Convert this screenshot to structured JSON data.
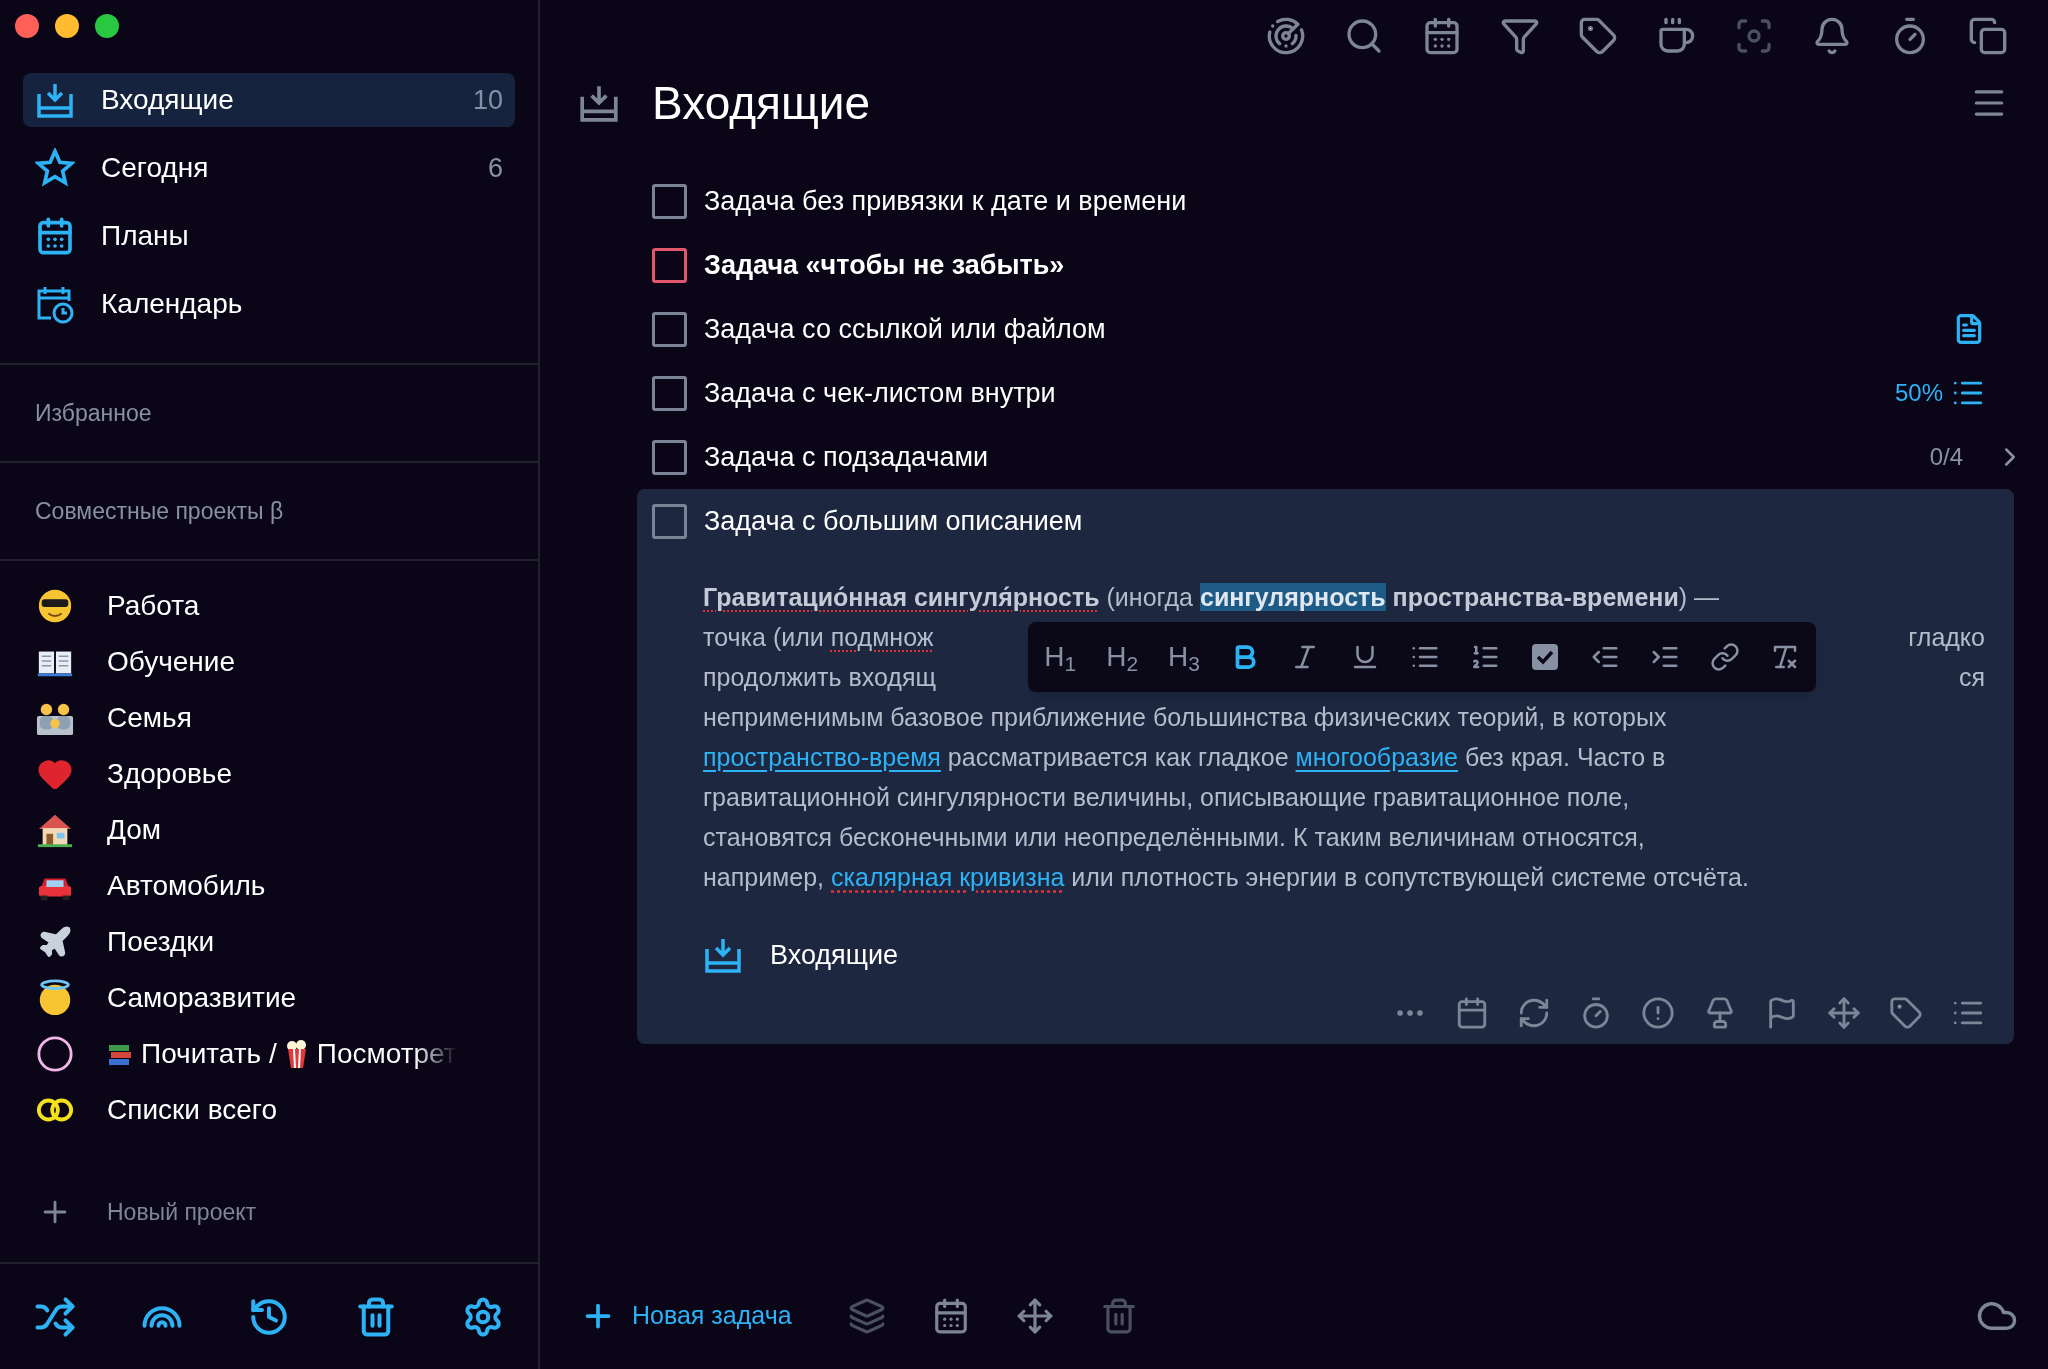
{
  "sidebar": {
    "nav": [
      {
        "label": "Входящие",
        "count": "10",
        "selected": true
      },
      {
        "label": "Сегодня",
        "count": "6",
        "selected": false
      },
      {
        "label": "Планы",
        "selected": false
      },
      {
        "label": "Календарь",
        "selected": false
      }
    ],
    "sections": [
      "Избранное",
      "Совместные проекты β"
    ],
    "projects": [
      {
        "label": "Работа"
      },
      {
        "label": "Обучение"
      },
      {
        "label": "Семья"
      },
      {
        "label": "Здоровье"
      },
      {
        "label": "Дом"
      },
      {
        "label": "Автомобиль"
      },
      {
        "label": "Поездки"
      },
      {
        "label": "Саморазвитие"
      },
      {
        "label": "Почитать /",
        "label_2": "Посмотрет"
      },
      {
        "label": "Списки всего"
      }
    ],
    "new_project": "Новый проект"
  },
  "top_toolbar": [
    {
      "disabled": false
    },
    {
      "disabled": false
    },
    {
      "disabled": false
    },
    {
      "disabled": false
    },
    {
      "disabled": false
    },
    {
      "disabled": false
    },
    {
      "disabled": true
    },
    {
      "disabled": false
    },
    {
      "disabled": false
    },
    {
      "disabled": false
    }
  ],
  "header": {
    "title": "Входящие"
  },
  "tasks": [
    {
      "title": "Задача без привязки к дате и времени",
      "checked": false,
      "important": false,
      "expanded": false
    },
    {
      "title": "Задача «чтобы не забыть»",
      "checked": false,
      "important": true,
      "expanded": false
    },
    {
      "title": "Задача со ссылкой или файлом",
      "checked": false,
      "important": false,
      "expanded": false,
      "kind": "note"
    },
    {
      "title": "Задача с чек-листом внутри",
      "checked": false,
      "important": false,
      "expanded": false,
      "kind": "checklist",
      "progress": "50%"
    },
    {
      "title": "Задача с подзадачами",
      "checked": false,
      "important": false,
      "expanded": false,
      "kind": "subtasks",
      "progress": "0/4"
    },
    {
      "title": "Задача с большим описанием",
      "checked": false,
      "important": false,
      "expanded": true,
      "description": [
        {
          "left": [
            {
              "text": "Гравитацио́нная сингуля́рность",
              "kind": "bold",
              "misspelled": true
            },
            {
              "text": " (иногда ",
              "kind": "plain",
              "misspelled": false
            },
            {
              "text": "сингулярность",
              "kind": "highlight",
              "misspelled": false
            },
            {
              "text": " пространства-времени",
              "kind": "bold",
              "misspelled": false
            },
            {
              "text": ") —",
              "kind": "plain",
              "misspelled": false
            }
          ]
        },
        {
          "left": [
            {
              "text": "точка (или ",
              "kind": "plain",
              "misspelled": false
            },
            {
              "text": "подмнож",
              "kind": "plain",
              "misspelled": true
            }
          ],
          "right": [
            {
              "text": "гладко",
              "kind": "plain",
              "misspelled": false
            }
          ]
        },
        {
          "left": [
            {
              "text": "продолжить входящ",
              "kind": "plain",
              "misspelled": false
            }
          ],
          "right": [
            {
              "text": "ся",
              "kind": "plain",
              "misspelled": false
            }
          ]
        },
        {
          "left": [
            {
              "text": "неприменимым базовое приближение большинства физических теорий, в которых",
              "kind": "plain",
              "misspelled": false
            }
          ]
        },
        {
          "left": [
            {
              "text": "пространство-время",
              "kind": "link",
              "misspelled": false
            },
            {
              "text": " рассматривается как гладкое ",
              "kind": "plain",
              "misspelled": false
            },
            {
              "text": "многообразие",
              "kind": "link",
              "misspelled": false
            },
            {
              "text": " без края. Часто в",
              "kind": "plain",
              "misspelled": false
            }
          ]
        },
        {
          "left": [
            {
              "text": "гравитационной сингулярности величины, описывающие гравитационное поле,",
              "kind": "plain",
              "misspelled": false
            }
          ]
        },
        {
          "left": [
            {
              "text": "становятся бесконечными или неопределёнными. К таким величинам относятся,",
              "kind": "plain",
              "misspelled": false
            }
          ]
        },
        {
          "left": [
            {
              "text": "например, ",
              "kind": "plain",
              "misspelled": false
            },
            {
              "text": "скалярная кривизна",
              "kind": "link",
              "misspelled": true
            },
            {
              "text": " или плотность энергии в сопутствующей системе отсчёта.",
              "kind": "plain",
              "misspelled": false
            }
          ]
        }
      ],
      "project": "Входящие"
    }
  ],
  "format_toolbar": {
    "headings": [
      "H$_{1}$",
      "H$_{2}$",
      "H$_{3}$"
    ],
    "tools": [
      {
        "active": true
      },
      {
        "active": false
      },
      {
        "active": false
      },
      {
        "active": false
      },
      {
        "active": false
      },
      {
        "active": false
      },
      {
        "active": false
      },
      {
        "active": false
      },
      {
        "active": false
      },
      {
        "active": false
      }
    ]
  },
  "bottom_bar": {
    "new_task": "Новая задача",
    "actions": [
      {
        "disabled": true
      },
      {
        "disabled": false
      },
      {
        "disabled": false
      },
      {
        "disabled": true
      }
    ]
  }
}
